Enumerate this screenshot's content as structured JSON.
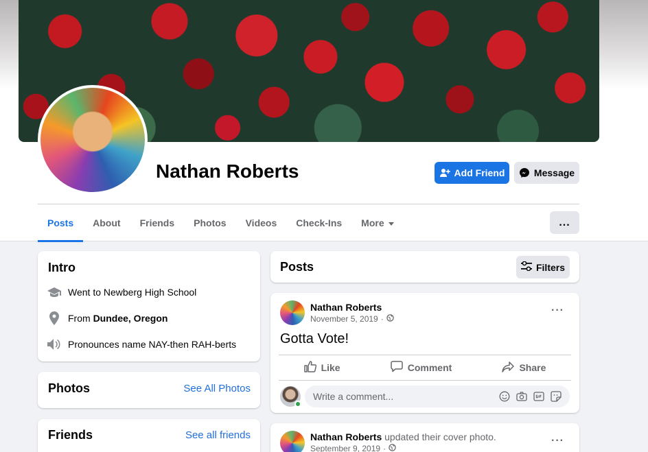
{
  "profile": {
    "name": "Nathan Roberts",
    "add_friend_label": "Add Friend",
    "message_label": "Message",
    "more_options_label": "..."
  },
  "tabs": [
    {
      "label": "Posts",
      "active": true
    },
    {
      "label": "About"
    },
    {
      "label": "Friends"
    },
    {
      "label": "Photos"
    },
    {
      "label": "Videos"
    },
    {
      "label": "Check-Ins"
    },
    {
      "label": "More"
    }
  ],
  "intro": {
    "title": "Intro",
    "education": "Went to Newberg High School",
    "from_prefix": "From",
    "from_place": "Dundee, Oregon",
    "pronunciation": "Pronounces name NAY-then RAH-berts"
  },
  "photos": {
    "title": "Photos",
    "link": "See All Photos"
  },
  "friends": {
    "title": "Friends",
    "link": "See all friends"
  },
  "posts": {
    "title": "Posts",
    "filters_label": "Filters",
    "items": [
      {
        "author": "Nathan Roberts",
        "action": "",
        "date": "November 5, 2019",
        "text": "Gotta Vote!",
        "like_label": "Like",
        "comment_label": "Comment",
        "share_label": "Share",
        "comment_placeholder": "Write a comment..."
      },
      {
        "author": "Nathan Roberts",
        "action": "updated their cover photo.",
        "date": "September 9, 2019"
      }
    ]
  },
  "colors": {
    "accent": "#1b74e4",
    "background": "#f0f2f5",
    "secondary_text": "#65676b",
    "link": "#216fdb"
  }
}
